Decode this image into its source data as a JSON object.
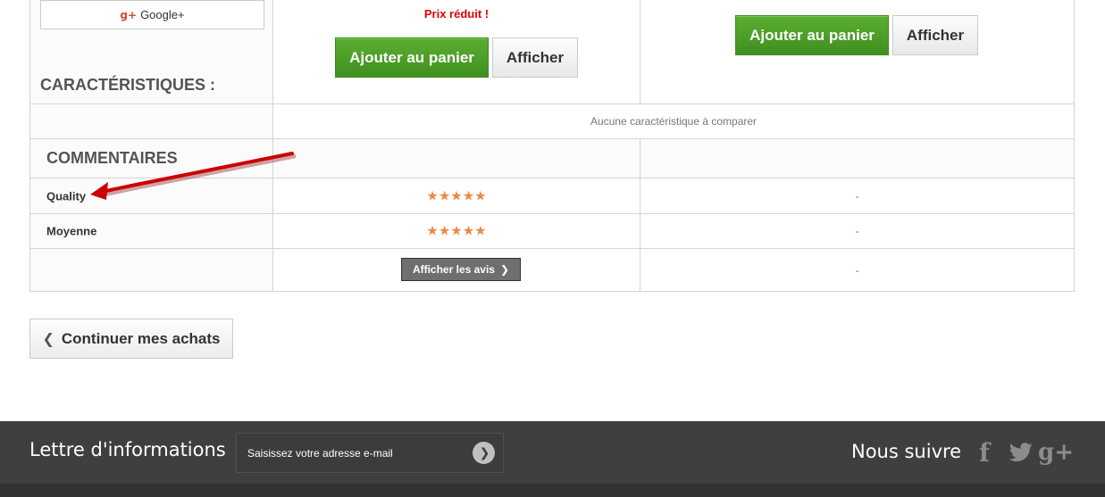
{
  "top": {
    "gplus_label": "Google+",
    "gplus_glyph": "g+",
    "characteristics_title": "Caractéristiques :",
    "product1": {
      "promo": "Prix réduit !",
      "add_to_cart": "Ajouter au panier",
      "view": "Afficher"
    },
    "product2": {
      "add_to_cart": "Ajouter au panier",
      "view": "Afficher"
    }
  },
  "features": {
    "empty_message": "Aucune caractéristique à comparer"
  },
  "comments": {
    "title": "Commentaires",
    "criteria": [
      {
        "label": "Quality",
        "product1_stars": "★★★★★",
        "product2_value": "-"
      },
      {
        "label": "Moyenne",
        "product1_stars": "★★★★★",
        "product2_value": "-"
      }
    ],
    "reviews_button": "Afficher les avis",
    "reviews_product2": "-"
  },
  "continue_button": "Continuer mes achats",
  "footer": {
    "newsletter_title": "Lettre d'informations",
    "newsletter_placeholder": "Saisissez votre adresse e-mail",
    "follow_title": "Nous suivre",
    "facebook_glyph": "f",
    "googleplus_glyph": "g+"
  },
  "colors": {
    "cart_green": "#4ea22b",
    "promo_red": "#e60000",
    "star_orange": "#ef8743",
    "annotation_red": "#cc0000",
    "footer_bg": "#3f3f3f"
  },
  "icons": {
    "gplus": "google-plus-icon",
    "arrow": "annotation-arrow",
    "chevron_right": "chevron-right-icon",
    "chevron_left": "chevron-left-icon",
    "facebook": "facebook-icon",
    "twitter": "twitter-icon",
    "googleplus": "google-plus-icon"
  }
}
